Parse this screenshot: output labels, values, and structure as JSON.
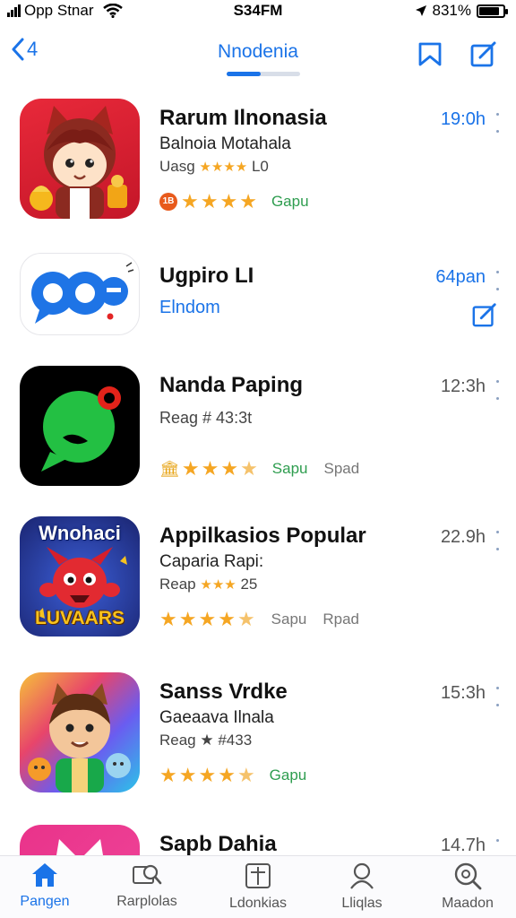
{
  "status_bar": {
    "carrier": "Opp Stnar",
    "time": "S34FM",
    "battery": "831%",
    "battery_level": 0.83
  },
  "nav": {
    "back_label": "4",
    "title": "Nnodenia"
  },
  "apps": [
    {
      "name": "Rarum Ilnonasia",
      "subtitle": "Balnoia Motahala",
      "rating_text": "Uasg",
      "rating_suffix": "L0",
      "stars": 4,
      "half": false,
      "badge": "1B",
      "tag_green": "Gapu",
      "tag_grey": "",
      "time": "19:0h",
      "time_blue": true,
      "icon": "fox-character-icon"
    },
    {
      "name": "Ugpiro LI",
      "subtitle": "Elndom",
      "time": "64pan",
      "time_blue": true,
      "icon": "chat-bubble-icon"
    },
    {
      "name": "Nanda Paping",
      "rating_text": "Reag # 43:3t",
      "stars": 4,
      "half": true,
      "tag_green": "Sapu",
      "tag_grey": "Spad",
      "time": "12:3h",
      "time_blue": false,
      "icon": "green-chat-icon"
    },
    {
      "name": "Appilkasios Popular",
      "subtitle": "Caparia Rapi:",
      "rating_text": "Reap",
      "rating_suffix": "25",
      "stars": 4,
      "half": true,
      "tag_green": "",
      "tag_grey_a": "Sapu",
      "tag_grey": "Rpad",
      "time": "22.9h",
      "time_blue": false,
      "icon": "monster-game-icon",
      "icon_text_top": "Wnohaci",
      "icon_text_bottom": "LUVAARS"
    },
    {
      "name": "Sanss Vrdke",
      "subtitle": "Gaeaava Ilnala",
      "rating_text": "Reag ★ #433",
      "stars": 4,
      "half": true,
      "tag_green": "Gapu",
      "tag_grey": "",
      "time": "15:3h",
      "time_blue": false,
      "icon": "boy-character-icon"
    },
    {
      "name": "Sapb Dahia",
      "time": "14.7h",
      "time_blue": false,
      "icon": "cat-icon"
    }
  ],
  "tabs": [
    {
      "label": "Pangen",
      "icon": "home-icon",
      "active": true
    },
    {
      "label": "Rarplolas",
      "icon": "search-apps-icon",
      "active": false
    },
    {
      "label": "Ldonkias",
      "icon": "add-box-icon",
      "active": false
    },
    {
      "label": "Lliqlas",
      "icon": "person-icon",
      "active": false
    },
    {
      "label": "Maadon",
      "icon": "magnify-icon",
      "active": false
    }
  ],
  "colors": {
    "accent": "#1a73e8",
    "star": "#f5a623",
    "green_tag": "#2e9d4f"
  }
}
